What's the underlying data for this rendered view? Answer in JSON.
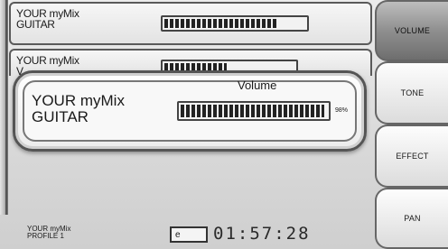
{
  "rows": [
    {
      "line1": "YOUR myMix",
      "line2": "GUITAR",
      "level": 0.8
    },
    {
      "line1": "YOUR myMix",
      "line2": "V",
      "level": 0.48
    }
  ],
  "popup": {
    "title": "Volume",
    "line1": "YOUR myMix",
    "line2": "GUITAR",
    "percent_text": "98%",
    "level": 0.98
  },
  "tabs": {
    "volume": "VOLUME",
    "tone": "TONE",
    "effect": "EFFECT",
    "pan": "PAN",
    "active": "volume"
  },
  "status": {
    "profile_line1": "YOUR myMix",
    "profile_line2": "PROFILE 1",
    "battery_label": "e",
    "time": "01:57:28"
  }
}
